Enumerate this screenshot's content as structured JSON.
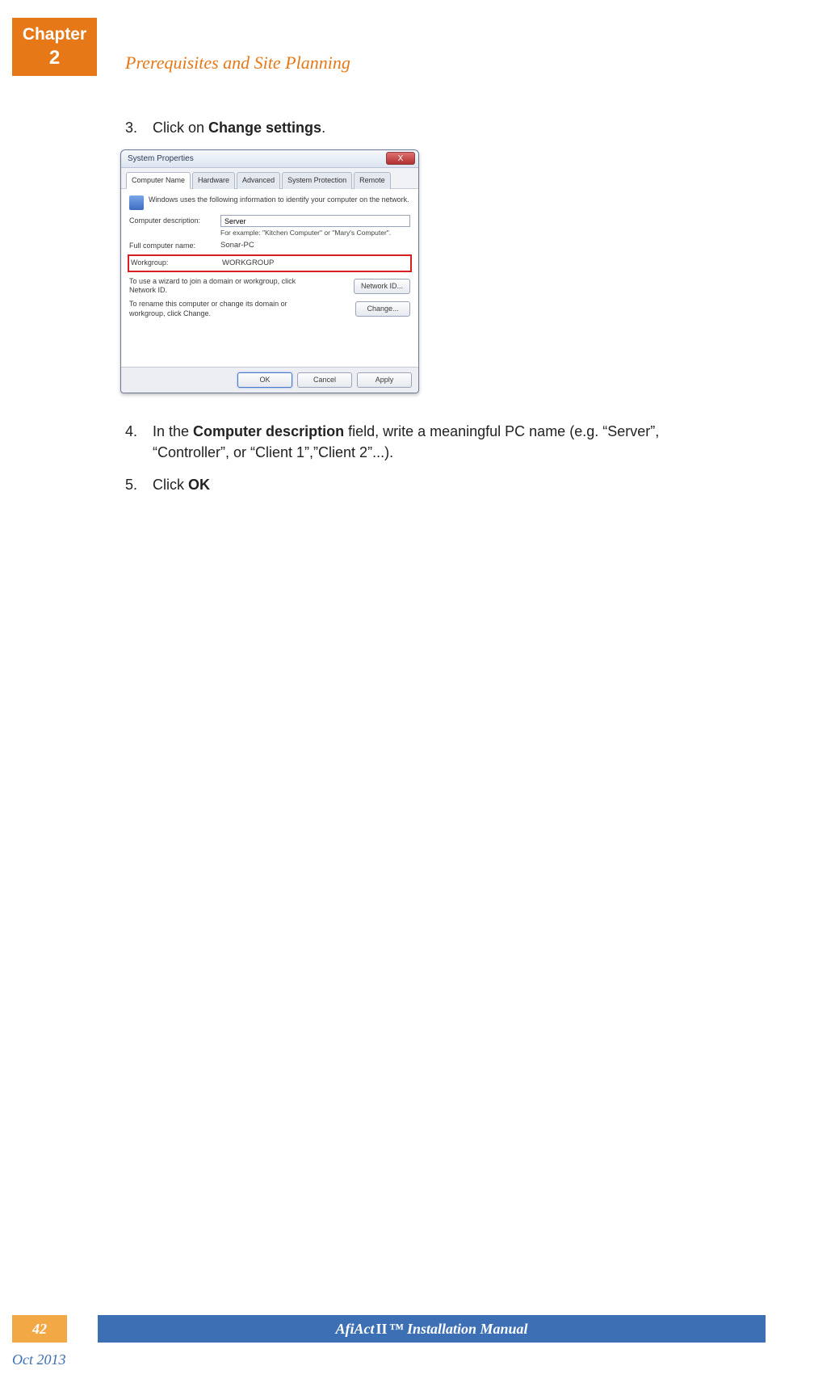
{
  "chapter": {
    "label": "Chapter",
    "number": "2"
  },
  "section_title": "Prerequisites and Site Planning",
  "steps": {
    "s3": {
      "num": "3.",
      "pre": "Click on ",
      "bold": "Change settings",
      "post": "."
    },
    "s4": {
      "num": "4.",
      "pre": "In the ",
      "bold": "Computer description",
      "post": " field, write a meaningful PC name (e.g. “Server”, “Controller”, or “Client 1”,”Client 2”...)."
    },
    "s5": {
      "num": "5.",
      "pre": "Click ",
      "bold": "OK",
      "post": ""
    }
  },
  "dialog": {
    "title": "System Properties",
    "close": "X",
    "tabs": [
      "Computer Name",
      "Hardware",
      "Advanced",
      "System Protection",
      "Remote"
    ],
    "info": "Windows uses the following information to identify your computer on the network.",
    "desc_label": "Computer description:",
    "desc_value": "Server",
    "desc_example": "For example: \"Kitchen Computer\" or \"Mary's Computer\".",
    "fullname_label": "Full computer name:",
    "fullname_value": "Sonar-PC",
    "workgroup_label": "Workgroup:",
    "workgroup_value": "WORKGROUP",
    "wizard_text": "To use a wizard to join a domain or workgroup, click Network ID.",
    "wizard_btn": "Network ID...",
    "rename_text": "To rename this computer or change its domain or workgroup, click Change.",
    "rename_btn": "Change...",
    "ok": "OK",
    "cancel": "Cancel",
    "apply": "Apply"
  },
  "footer": {
    "page": "42",
    "manual_pre": "AfiAct ",
    "manual_roman": "II",
    "manual_post": "™ Installation Manual",
    "date": "Oct 2013"
  }
}
